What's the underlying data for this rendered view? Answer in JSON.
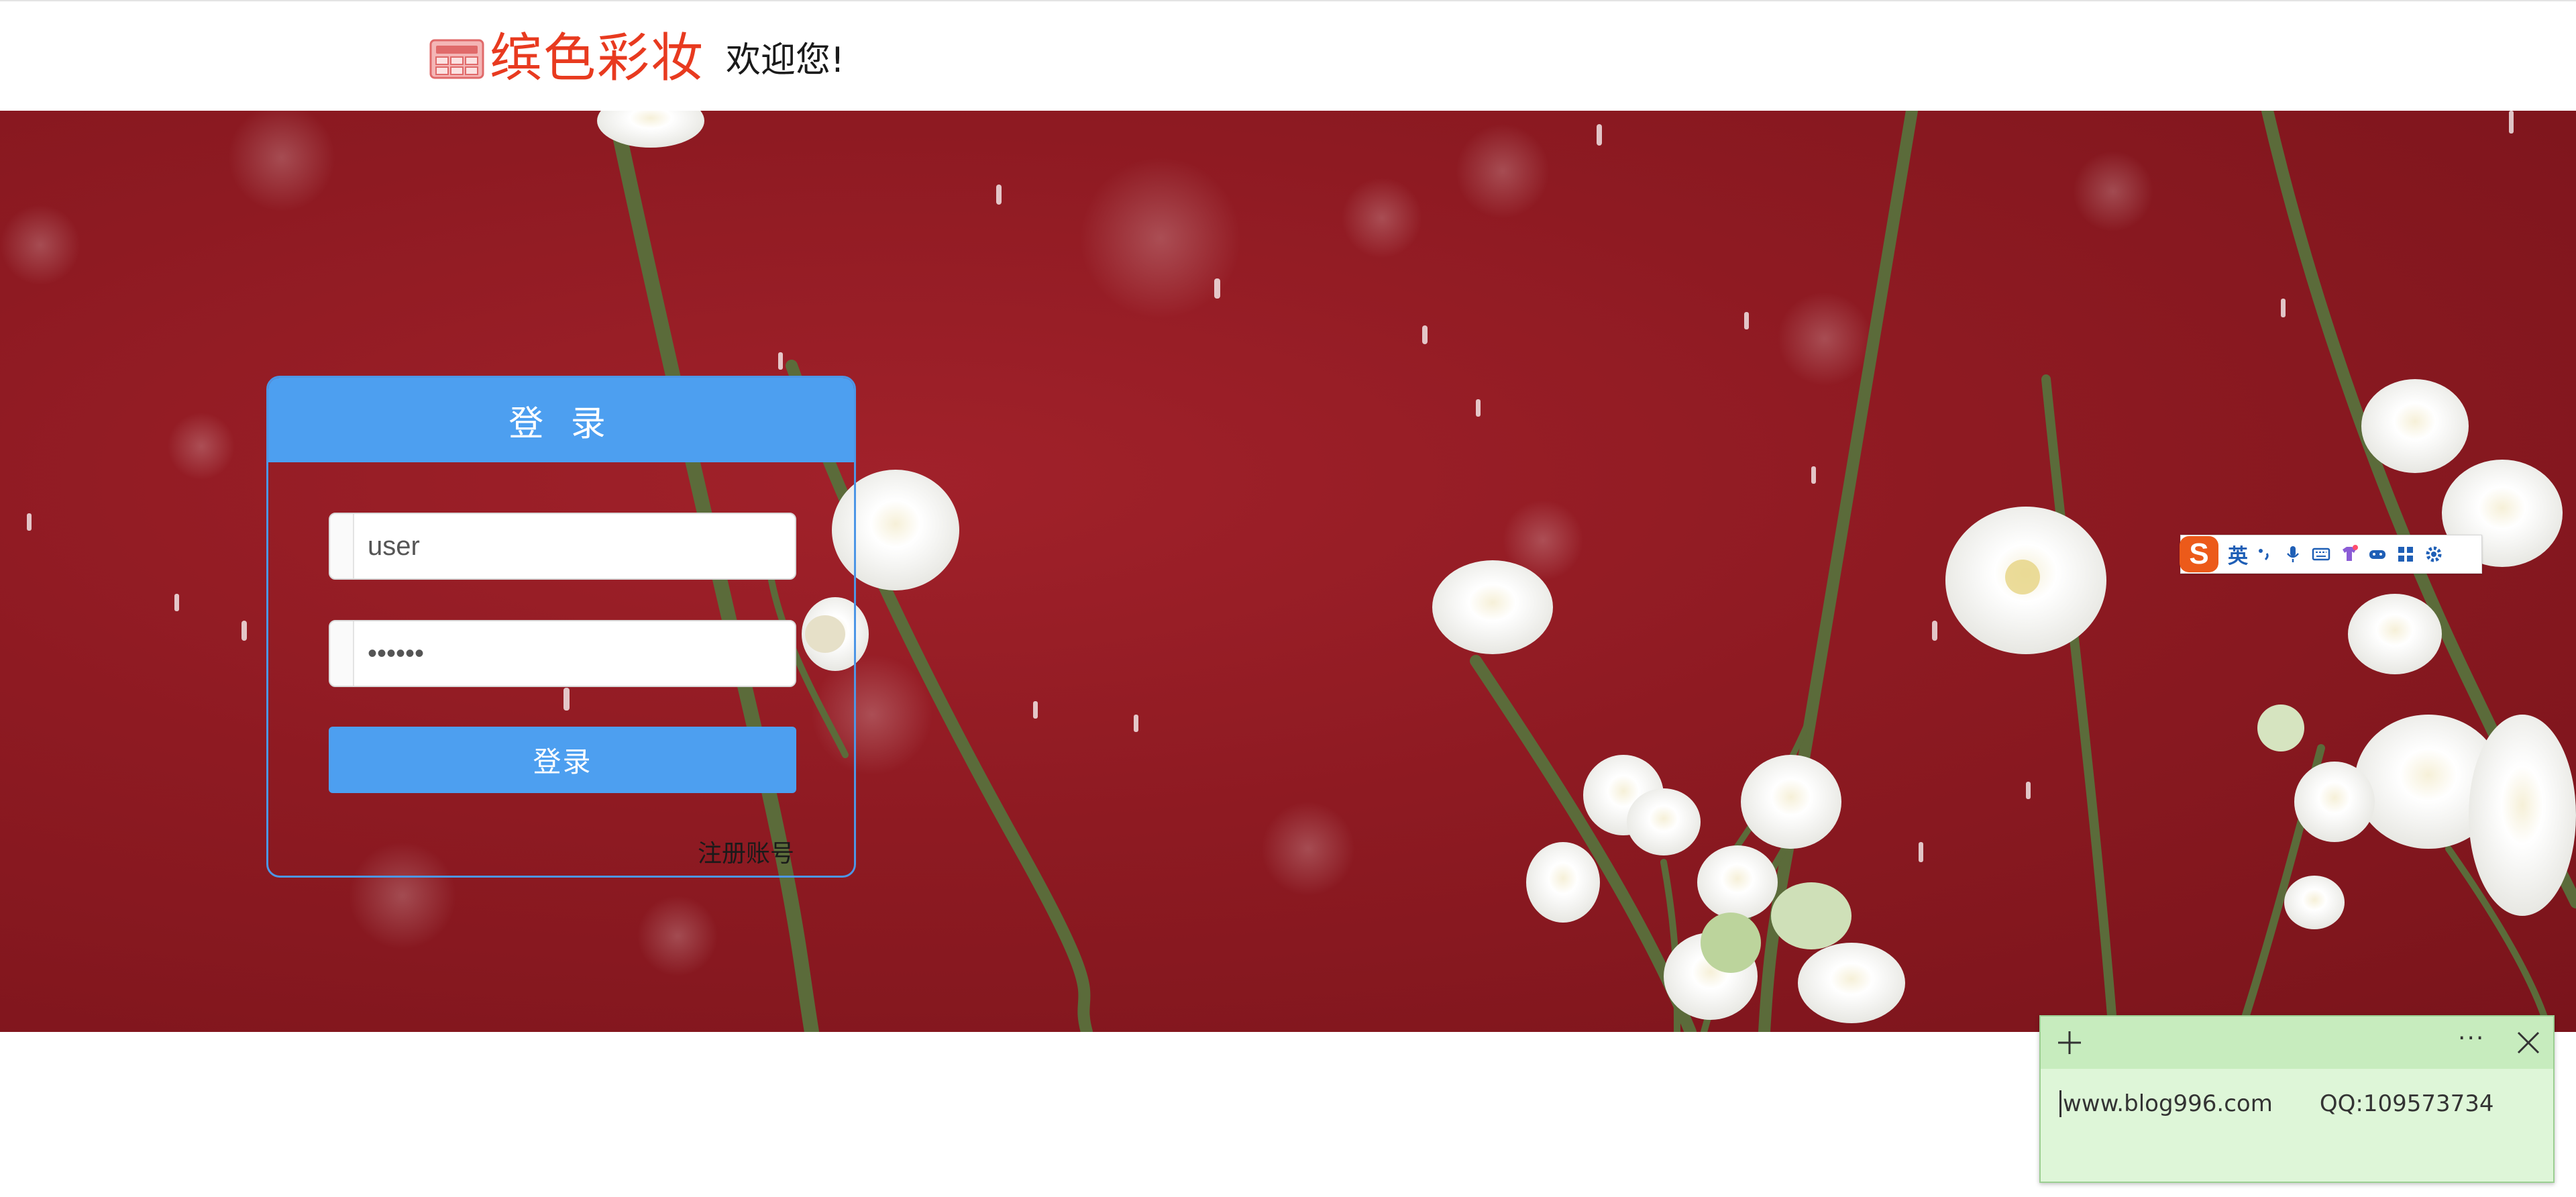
{
  "header": {
    "brand": "缤色彩妆",
    "welcome": "欢迎您!",
    "brand_color": "#e83a1f",
    "logo_icon": "makeup-palette-icon"
  },
  "login": {
    "title": "登 录",
    "username_value": "user",
    "password_value": "••••••",
    "submit_label": "登录",
    "register_link": "注册账号",
    "accent_color": "#4d9ff0"
  },
  "ime_toolbar": {
    "logo": "S",
    "language": "英",
    "icons": [
      "punctuation-icon",
      "microphone-icon",
      "keyboard-icon",
      "skin-icon",
      "gamepad-icon",
      "apps-grid-icon",
      "settings-icon"
    ]
  },
  "sticky_note": {
    "website": "www.blog996.com",
    "qq": "QQ:109573734",
    "more_label": "···"
  }
}
